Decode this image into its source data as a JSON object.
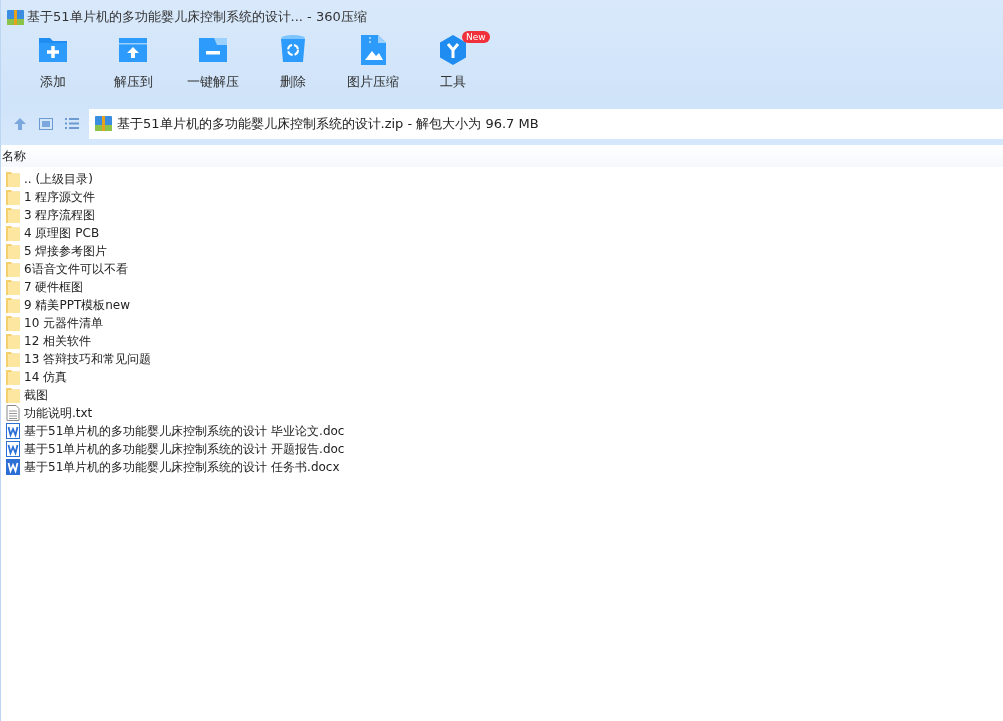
{
  "window": {
    "title": "基于51单片机的多功能婴儿床控制系统的设计... - 360压缩"
  },
  "toolbar": [
    {
      "kind": "add",
      "label": "添加"
    },
    {
      "kind": "extract",
      "label": "解压到"
    },
    {
      "kind": "oneclick",
      "label": "一键解压"
    },
    {
      "kind": "delete",
      "label": "删除"
    },
    {
      "kind": "image",
      "label": "图片压缩"
    },
    {
      "kind": "tools",
      "label": "工具",
      "badge": "New"
    }
  ],
  "address": {
    "value": "基于51单片机的多功能婴儿床控制系统的设计.zip - 解包大小为 96.7 MB"
  },
  "table": {
    "columns": [
      "名称"
    ],
    "rows": [
      {
        "kind": "folder",
        "name": ".. (上级目录)"
      },
      {
        "kind": "folder",
        "name": "1 程序源文件"
      },
      {
        "kind": "folder",
        "name": "3 程序流程图"
      },
      {
        "kind": "folder",
        "name": "4 原理图 PCB"
      },
      {
        "kind": "folder",
        "name": "5 焊接参考图片"
      },
      {
        "kind": "folder",
        "name": "6语音文件可以不看"
      },
      {
        "kind": "folder",
        "name": "7 硬件框图"
      },
      {
        "kind": "folder",
        "name": "9 精美PPT模板new"
      },
      {
        "kind": "folder",
        "name": "10 元器件清单"
      },
      {
        "kind": "folder",
        "name": "12 相关软件"
      },
      {
        "kind": "folder",
        "name": "13 答辩技巧和常见问题"
      },
      {
        "kind": "folder",
        "name": "14 仿真"
      },
      {
        "kind": "folder",
        "name": "截图"
      },
      {
        "kind": "txt",
        "name": "功能说明.txt"
      },
      {
        "kind": "doc",
        "name": "基于51单片机的多功能婴儿床控制系统的设计  毕业论文.doc"
      },
      {
        "kind": "doc",
        "name": "基于51单片机的多功能婴儿床控制系统的设计 开题报告.doc"
      },
      {
        "kind": "docx",
        "name": "基于51单片机的多功能婴儿床控制系统的设计 任务书.docx"
      }
    ]
  }
}
